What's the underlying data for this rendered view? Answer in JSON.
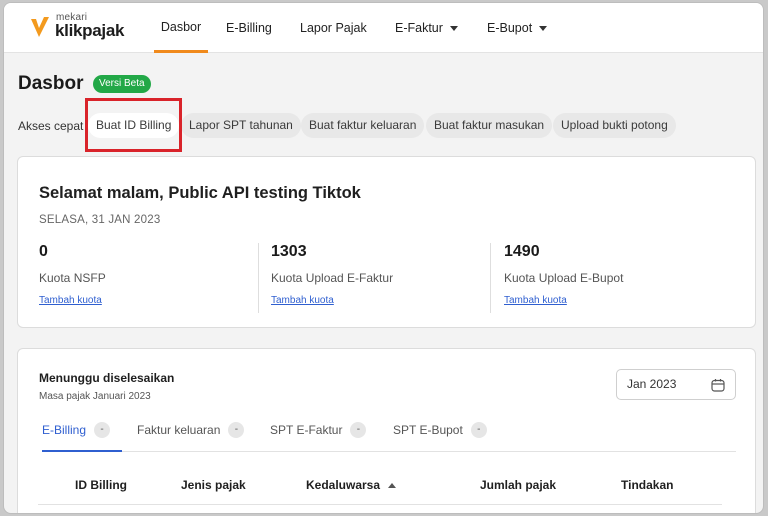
{
  "logo": {
    "sub": "mekari",
    "brand": "klikpajak"
  },
  "nav": [
    {
      "label": "Dasbor",
      "active": true,
      "dropdown": false
    },
    {
      "label": "E-Billing",
      "active": false,
      "dropdown": false
    },
    {
      "label": "Lapor Pajak",
      "active": false,
      "dropdown": false
    },
    {
      "label": "E-Faktur",
      "active": false,
      "dropdown": true
    },
    {
      "label": "E-Bupot",
      "active": false,
      "dropdown": true
    }
  ],
  "page": {
    "title": "Dasbor",
    "badge": "Versi Beta"
  },
  "quick_access": {
    "label": "Akses cepat",
    "items": [
      "Buat ID Billing",
      "Lapor SPT tahunan",
      "Buat faktur keluaran",
      "Buat faktur masukan",
      "Upload bukti potong"
    ]
  },
  "welcome": {
    "greeting": "Selamat malam, Public API testing Tiktok",
    "date": "SELASA, 31 JAN 2023",
    "stats": [
      {
        "value": "0",
        "label": "Kuota NSFP",
        "link": "Tambah kuota"
      },
      {
        "value": "1303",
        "label": "Kuota Upload E-Faktur",
        "link": "Tambah kuota"
      },
      {
        "value": "1490",
        "label": "Kuota Upload E-Bupot",
        "link": "Tambah kuota"
      }
    ]
  },
  "pending": {
    "title": "Menunggu diselesaikan",
    "subtitle": "Masa pajak Januari 2023",
    "period_select": "Jan 2023",
    "tabs": [
      {
        "label": "E-Billing",
        "count": "-",
        "active": true
      },
      {
        "label": "Faktur keluaran",
        "count": "-",
        "active": false
      },
      {
        "label": "SPT E-Faktur",
        "count": "-",
        "active": false
      },
      {
        "label": "SPT E-Bupot",
        "count": "-",
        "active": false
      }
    ],
    "columns": [
      "ID Billing",
      "Jenis pajak",
      "Kedaluwarsa",
      "Jumlah pajak",
      "Tindakan"
    ]
  },
  "colors": {
    "accent": "#f08a1c",
    "link": "#2f5fd0",
    "badge": "#22a847",
    "highlight_box": "#d9232a"
  }
}
